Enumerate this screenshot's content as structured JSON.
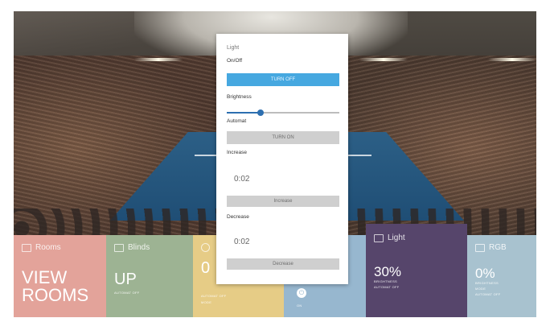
{
  "modal": {
    "title": "Light",
    "onoff_label": "On/Off",
    "onoff_button": "TURN OFF",
    "brightness_label": "Brightness",
    "brightness_level": 0.3,
    "automat_label": "Automat",
    "automat_button": "TURN ON",
    "increase_label": "Increase",
    "increase_value": "0:02",
    "increase_button": "Increase",
    "decrease_label": "Decrease",
    "decrease_value": "0:02",
    "decrease_button": "Decrease"
  },
  "tiles": {
    "rooms": {
      "title": "Rooms",
      "value_line1": "VIEW",
      "value_line2": "ROOMS",
      "color": "#e3a39a"
    },
    "blinds": {
      "title": "Blinds",
      "value": "UP",
      "sub": "AUTOMAT OFF",
      "color": "#9db393"
    },
    "yellow": {
      "value": "0",
      "sub1": "AUTOMAT OFF",
      "sub2": "MODE",
      "color": "#e6cc86"
    },
    "blue": {
      "icon": "power-icon",
      "sub": "ON",
      "color": "#97b7cf"
    },
    "light": {
      "title": "Light",
      "value": "30%",
      "sub1": "BRIGHTNESS",
      "sub2": "AUTOMAT OFF",
      "color": "#56456b"
    },
    "rgb": {
      "title": "RGB",
      "value": "0%",
      "sub1": "BRIGHTNESS",
      "sub2": "MODE",
      "sub3": "AUTOMAT OFF",
      "color": "#a8c2cf"
    }
  },
  "colors": {
    "accent_button": "#46a8e0",
    "slider": "#2d6fb0"
  }
}
